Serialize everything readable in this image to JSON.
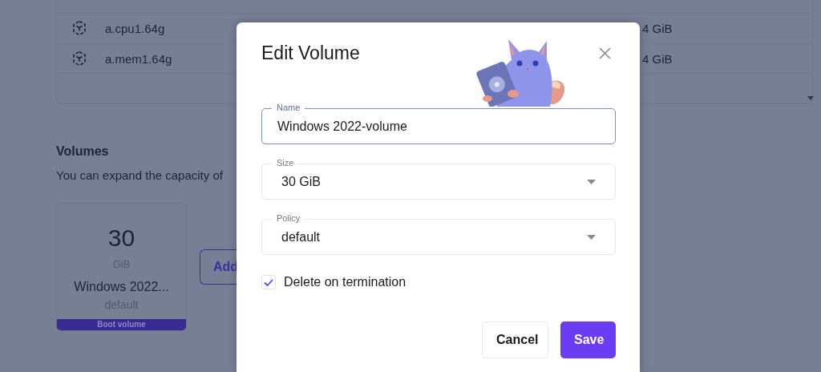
{
  "instance_table": {
    "rows": [
      {
        "name": "a.cpu1.64g",
        "memory": "4 GiB"
      },
      {
        "name": "a.mem1.64g",
        "memory": "4 GiB"
      }
    ]
  },
  "volumes_section": {
    "title": "Volumes",
    "description": "You can expand the capacity of",
    "volume_cards": [
      {
        "size": "30",
        "unit": "GiB",
        "name": "Windows 2022...",
        "policy": "default",
        "badge": "Boot volume"
      }
    ],
    "add_button": "Add"
  },
  "dialog": {
    "title": "Edit Volume",
    "fields": [
      {
        "kind": "text",
        "label": "Name",
        "value": "Windows 2022-volume",
        "focused": true
      },
      {
        "kind": "select",
        "label": "Size",
        "value": "30 GiB",
        "focused": false
      },
      {
        "kind": "select",
        "label": "Policy",
        "value": "default",
        "focused": false
      }
    ],
    "checkbox": {
      "label": "Delete on termination",
      "checked": true
    },
    "buttons": [
      {
        "label": "Cancel",
        "kind": "secondary"
      },
      {
        "label": "Save",
        "kind": "primary"
      }
    ]
  }
}
